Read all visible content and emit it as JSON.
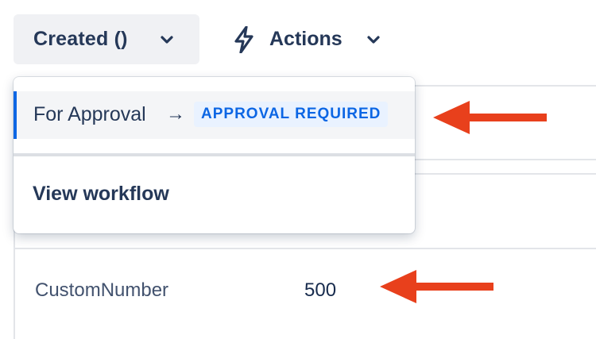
{
  "toolbar": {
    "status_label": "Created ()",
    "actions_label": "Actions"
  },
  "dropdown": {
    "transition": {
      "name": "For Approval",
      "arrow": "→",
      "badge": "APPROVAL REQUIRED"
    },
    "view_workflow": "View workflow"
  },
  "fields": [
    {
      "label": "CustomNumber",
      "value": "500"
    }
  ],
  "colors": {
    "annotation_arrow": "#e8401c",
    "badge_text": "#0c66e4",
    "badge_bg": "#e9f2ff",
    "selected_bar": "#0c66e4"
  },
  "icons": {
    "status_chevron": "chevron-down-icon",
    "actions_icon": "lightning-bolt-icon",
    "actions_chevron": "chevron-down-icon"
  }
}
